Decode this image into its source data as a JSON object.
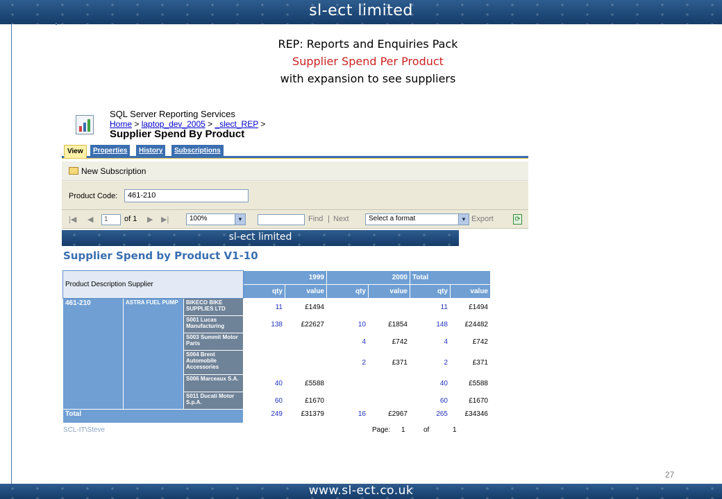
{
  "slide": {
    "top_banner": "sl-ect limited",
    "bottom_banner": "www.sl-ect.co.uk",
    "title_line1": "REP: Reports and Enquiries Pack",
    "title_line2": "Supplier Spend Per Product",
    "title_line3": "with expansion to see suppliers",
    "page_number": "27",
    "accent_color": "#cc2222"
  },
  "ssrs": {
    "app_name": "SQL Server Reporting Services",
    "breadcrumb": [
      "Home",
      ">",
      "laptop_dev_2005",
      ">",
      "_slect_REP",
      ">"
    ],
    "report_name": "Supplier Spend By Product",
    "tabs": [
      "View",
      "Properties",
      "History",
      "Subscriptions"
    ],
    "new_subscription": "New Subscription",
    "param_label": "Product Code:",
    "param_value": "461-210",
    "nav": {
      "page_value": "1",
      "of_label": "of 1",
      "zoom": "100%",
      "find": "Find",
      "sep": "|",
      "next": "Next",
      "format": "Select a format",
      "export": "Export"
    },
    "report_banner": "sl-ect limited"
  },
  "report": {
    "title": "Supplier Spend by Product V1-10",
    "header_left": "Product Description Supplier",
    "years": [
      "1999",
      "2000",
      "Total"
    ],
    "col_qty": "qty",
    "col_value": "value",
    "product_code": "461-210",
    "product_desc": "ASTRA FUEL PUMP",
    "rows": [
      {
        "supplier": "BIKECO BIKE SUPPLIES LTD",
        "q1999": "11",
        "v1999": "£1494",
        "q2000": "",
        "v2000": "",
        "qt": "11",
        "vt": "£1494"
      },
      {
        "supplier": "S001 Lucas Manufacturing",
        "q1999": "138",
        "v1999": "£22627",
        "q2000": "10",
        "v2000": "£1854",
        "qt": "148",
        "vt": "£24482"
      },
      {
        "supplier": "S003 Summit Motor Parts",
        "q1999": "",
        "v1999": "",
        "q2000": "4",
        "v2000": "£742",
        "qt": "4",
        "vt": "£742"
      },
      {
        "supplier": "S004 Brent Automobile Accessories",
        "q1999": "",
        "v1999": "",
        "q2000": "2",
        "v2000": "£371",
        "qt": "2",
        "vt": "£371"
      },
      {
        "supplier": "S006 Marceaux S.A.",
        "q1999": "40",
        "v1999": "£5588",
        "q2000": "",
        "v2000": "",
        "qt": "40",
        "vt": "£5588"
      },
      {
        "supplier": "S011 Ducati Motor S.p.A.",
        "q1999": "60",
        "v1999": "£1670",
        "q2000": "",
        "v2000": "",
        "qt": "60",
        "vt": "£1670"
      }
    ],
    "total": {
      "label": "Total",
      "q1999": "249",
      "v1999": "£31379",
      "q2000": "16",
      "v2000": "£2967",
      "qt": "265",
      "vt": "£34346"
    },
    "footer_user": "SCL-IT\\Steve",
    "footer_page_label": "Page:",
    "footer_page": "1",
    "footer_of": "of",
    "footer_pages": "1"
  }
}
